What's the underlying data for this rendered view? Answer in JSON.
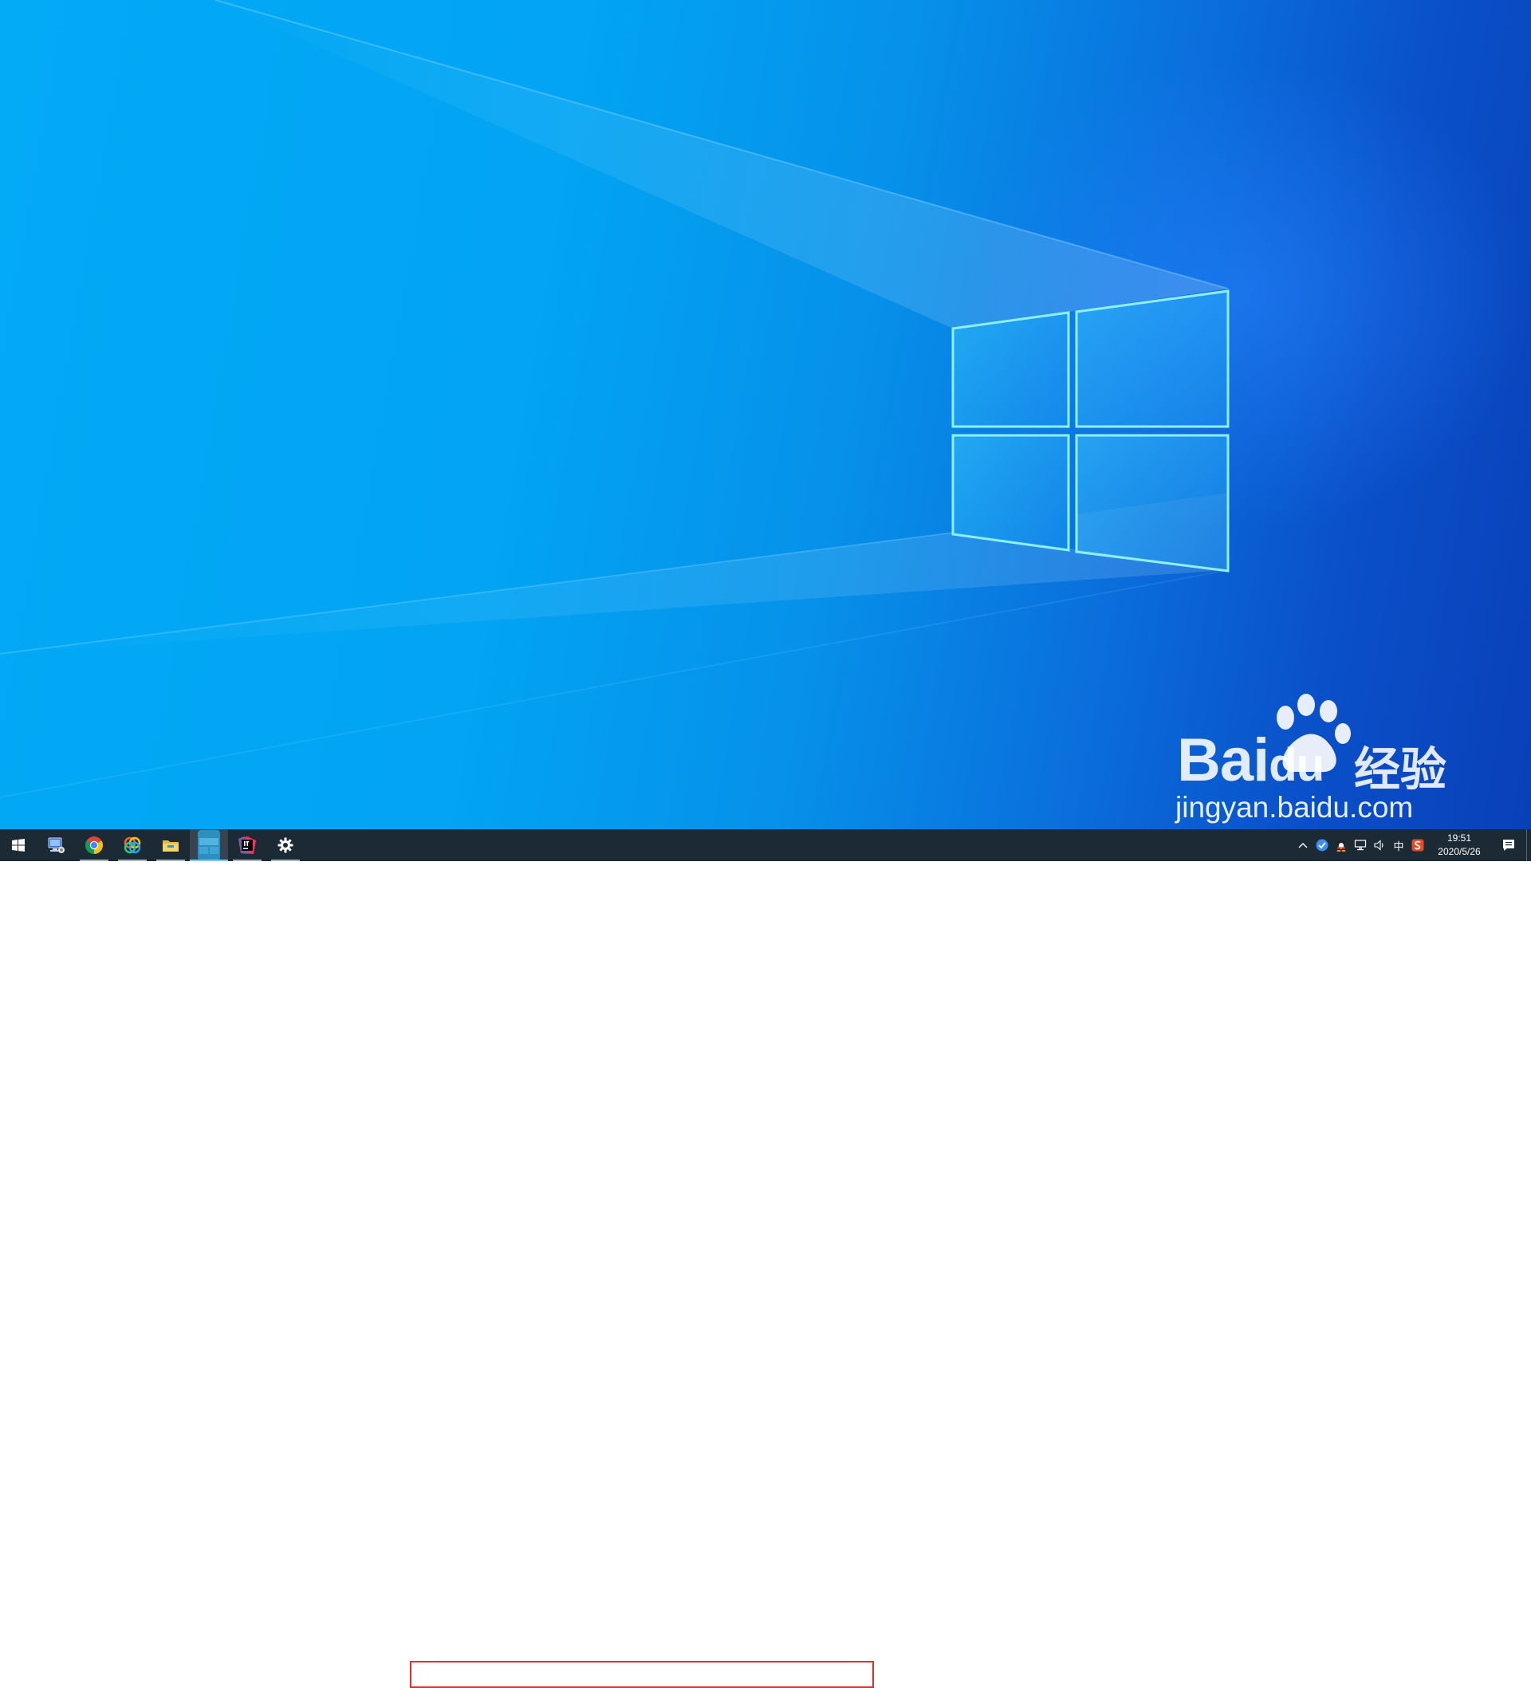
{
  "desktop": {
    "wallpaper": "windows-10-hero-wallpaper",
    "watermark": {
      "brand": "Bai",
      "brand_du": "du",
      "cn": "经验",
      "url": "jingyan.baidu.com"
    }
  },
  "taskbar": {
    "background": "#1c2a36",
    "apps": [
      {
        "name": "start",
        "icon": "windows-start-icon"
      },
      {
        "name": "this-pc",
        "icon": "computer-icon"
      },
      {
        "name": "chrome",
        "icon": "chrome-icon"
      },
      {
        "name": "colorful-app",
        "icon": "rings-app-icon"
      },
      {
        "name": "file-explorer",
        "icon": "folder-icon"
      },
      {
        "name": "active-window",
        "icon": "window-app-icon"
      },
      {
        "name": "intellij",
        "icon": "intellij-icon"
      },
      {
        "name": "settings",
        "icon": "gear-icon"
      }
    ],
    "highlight_color": "#e2312d",
    "tray": {
      "ime_label": "中",
      "time": "19:51",
      "date": "2020/5/26"
    }
  }
}
